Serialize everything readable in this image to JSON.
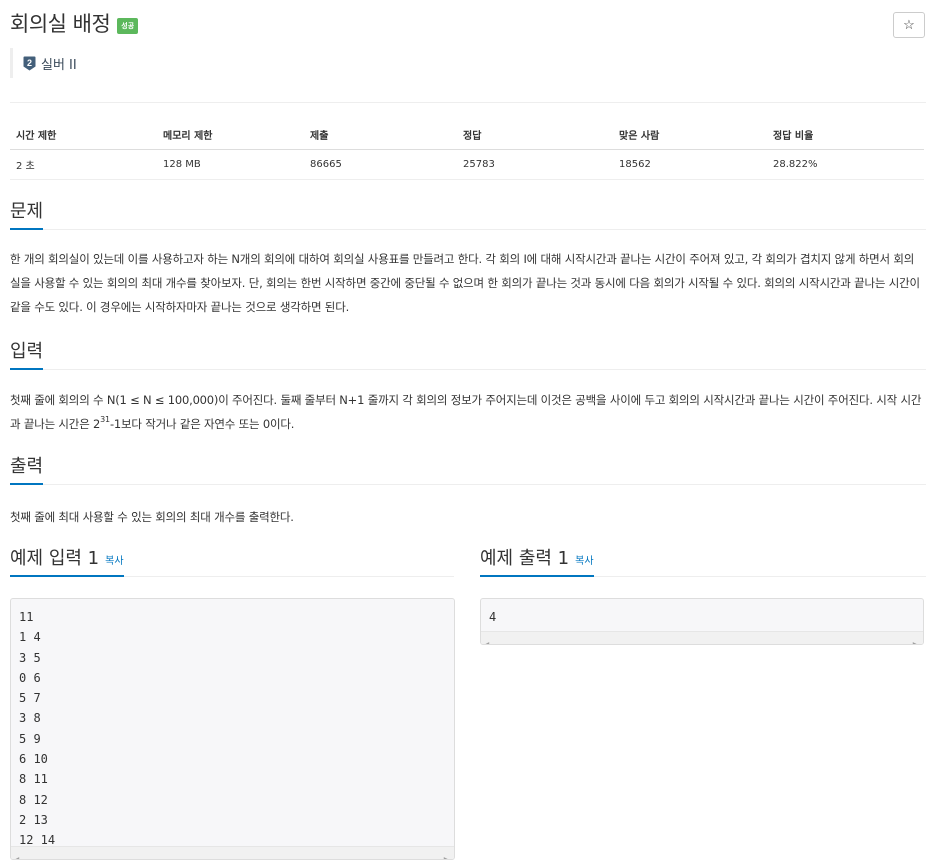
{
  "problem": {
    "title": "회의실 배정",
    "result_badge": "성공",
    "tier": {
      "number": "2",
      "label": "실버 II",
      "color": "#435f7a"
    }
  },
  "star_button": {
    "icon": "star-outline-icon",
    "glyph": "☆"
  },
  "info_table": {
    "headers": [
      "시간 제한",
      "메모리 제한",
      "제출",
      "정답",
      "맞은 사람",
      "정답 비율"
    ],
    "values": [
      "2 초",
      "128 MB",
      "86665",
      "25783",
      "18562",
      "28.822%"
    ]
  },
  "sections": {
    "description": {
      "heading": "문제",
      "text": "한 개의 회의실이 있는데 이를 사용하고자 하는 N개의 회의에 대하여 회의실 사용표를 만들려고 한다. 각 회의 I에 대해 시작시간과 끝나는 시간이 주어져 있고, 각 회의가 겹치지 않게 하면서 회의실을 사용할 수 있는 회의의 최대 개수를 찾아보자. 단, 회의는 한번 시작하면 중간에 중단될 수 없으며 한 회의가 끝나는 것과 동시에 다음 회의가 시작될 수 있다. 회의의 시작시간과 끝나는 시간이 같을 수도 있다. 이 경우에는 시작하자마자 끝나는 것으로 생각하면 된다."
    },
    "input": {
      "heading": "입력",
      "text_before_sup": "첫째 줄에 회의의 수 N(1 ≤ N ≤ 100,000)이 주어진다. 둘째 줄부터 N+1 줄까지 각 회의의 정보가 주어지는데 이것은 공백을 사이에 두고 회의의 시작시간과 끝나는 시간이 주어진다. 시작 시간과 끝나는 시간은 2",
      "sup": "31",
      "text_after_sup": "-1보다 작거나 같은 자연수 또는 0이다."
    },
    "output": {
      "heading": "출력",
      "text": "첫째 줄에 최대 사용할 수 있는 회의의 최대 개수를 출력한다."
    }
  },
  "samples": {
    "input": {
      "heading": "예제 입력 1",
      "copy_label": "복사",
      "lines": [
        "11",
        "1 4",
        "3 5",
        "0 6",
        "5 7",
        "3 8",
        "5 9",
        "6 10",
        "8 11",
        "8 12",
        "2 13",
        "12 14"
      ]
    },
    "output": {
      "heading": "예제 출력 1",
      "copy_label": "복사",
      "lines": [
        "4"
      ]
    }
  }
}
